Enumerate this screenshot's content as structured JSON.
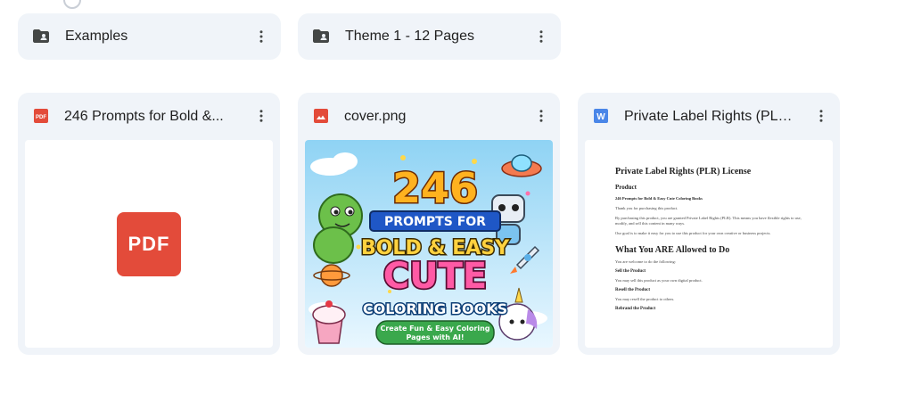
{
  "folders": [
    {
      "name": "Examples"
    },
    {
      "name": "Theme 1 - 12 Pages"
    }
  ],
  "files": [
    {
      "title": "246 Prompts for Bold &...",
      "icon": "pdf-icon",
      "preview": {
        "badge": "PDF"
      }
    },
    {
      "title": "cover.png",
      "icon": "image-icon",
      "preview": {
        "number": "246",
        "banner": "PROMPTS FOR",
        "line1": "BOLD & EASY",
        "line2": "CUTE",
        "line3": "COLORING BOOKS",
        "subtitle1": "Create Fun & Easy Coloring",
        "subtitle2": "Pages with AI!"
      }
    },
    {
      "title": "Private Label Rights (PLR)...",
      "icon": "word-icon",
      "preview": {
        "title": "Private Label Rights (PLR) License",
        "product_heading": "Product",
        "product_name": "246 Prompts for Bold & Easy Cute Coloring Books",
        "thanks": "Thank you for purchasing this product.",
        "grant": "By purchasing this product, you are granted Private Label Rights (PLR). This means you have flexible rights to use, modify, and sell this content in many ways.",
        "goal": "Our goal is to make it easy for you to use this product for your own creative or business projects.",
        "allowed_heading": "What You ARE Allowed to Do",
        "welcome": "You are welcome to do the following:",
        "sell_heading": "Sell the Product",
        "sell_text": "You may sell this product as your own digital product.",
        "resell_heading": "Resell the Product",
        "resell_text": "You may resell the product to others.",
        "rebrand_heading": "Rebrand the Product"
      }
    }
  ],
  "colors": {
    "card_bg": "#f0f4f9",
    "pdf_red": "#e34b3a",
    "image_red": "#e34b3a",
    "word_blue": "#4a86e8"
  }
}
